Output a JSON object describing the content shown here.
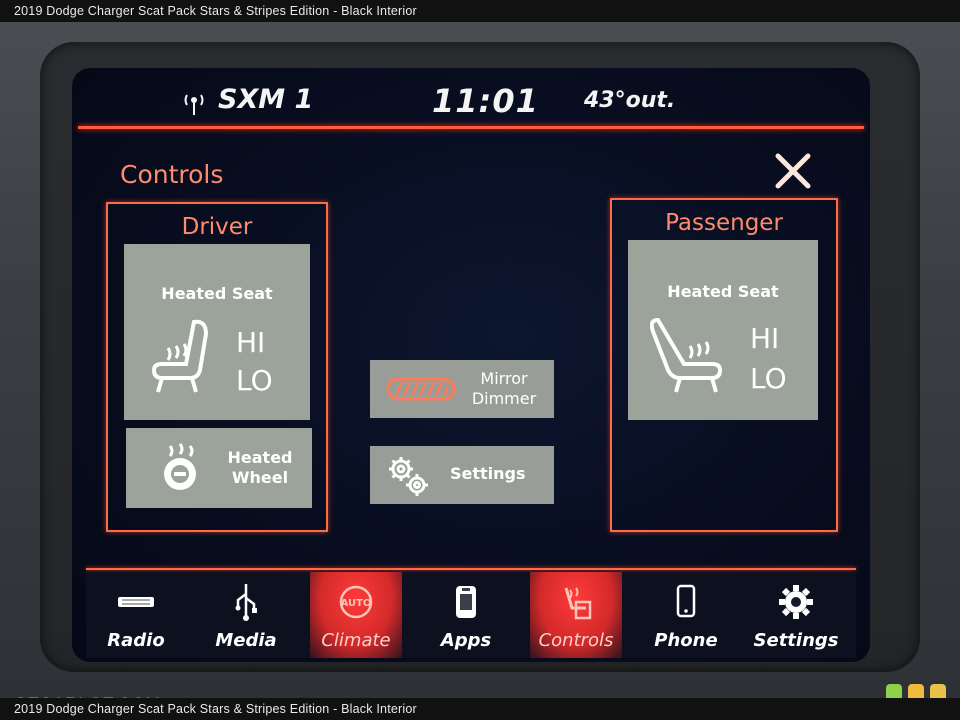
{
  "caption": {
    "top": "2019 Dodge Charger Scat Pack Stars & Stripes Edition - Black Interior",
    "bottom": "2019 Dodge Charger Scat Pack Stars & Stripes Edition - Black Interior"
  },
  "status": {
    "source": "SXM 1",
    "time": "11:01",
    "temperature": "43°out."
  },
  "screen_title": "Controls",
  "driver": {
    "title": "Driver",
    "heated_seat_label": "Heated Seat",
    "hi": "HI",
    "lo": "LO",
    "heated_wheel_line1": "Heated",
    "heated_wheel_line2": "Wheel"
  },
  "passenger": {
    "title": "Passenger",
    "heated_seat_label": "Heated Seat",
    "hi": "HI",
    "lo": "LO"
  },
  "center": {
    "mirror_line1": "Mirror",
    "mirror_line2": "Dimmer",
    "settings": "Settings"
  },
  "nav": [
    {
      "label": "Radio",
      "icon": "radio-icon",
      "active": false
    },
    {
      "label": "Media",
      "icon": "usb-icon",
      "active": false
    },
    {
      "label": "Climate",
      "icon": "climate-auto-icon",
      "active": true
    },
    {
      "label": "Apps",
      "icon": "apps-icon",
      "active": false
    },
    {
      "label": "Controls",
      "icon": "controls-icon",
      "active": true
    },
    {
      "label": "Phone",
      "icon": "phone-icon",
      "active": false
    },
    {
      "label": "Settings",
      "icon": "gear-icon",
      "active": false
    }
  ],
  "climate_icon_text": "AUTO",
  "watermark": "GTCARLOT.COM",
  "colors": {
    "accent": "#ff6a48",
    "accent_text": "#ff8a6e",
    "tile": "#9ca39a",
    "active_nav": "#d42a2a",
    "screen_bg": "#080d1f"
  }
}
